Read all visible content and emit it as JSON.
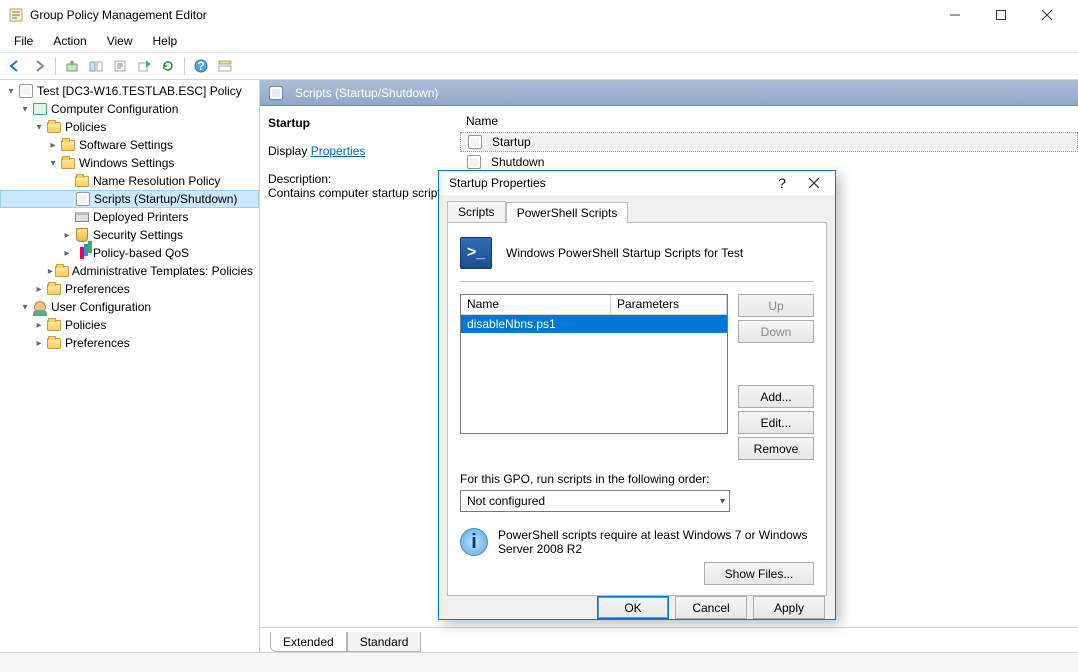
{
  "window": {
    "title": "Group Policy Management Editor"
  },
  "menu": {
    "file": "File",
    "action": "Action",
    "view": "View",
    "help": "Help"
  },
  "tree": {
    "root": "Test [DC3-W16.TESTLAB.ESC] Policy",
    "compConfig": "Computer Configuration",
    "policies": "Policies",
    "software": "Software Settings",
    "windows": "Windows Settings",
    "nrp": "Name Resolution Policy",
    "scripts": "Scripts (Startup/Shutdown)",
    "printers": "Deployed Printers",
    "security": "Security Settings",
    "qos": "Policy-based QoS",
    "admin": "Administrative Templates: Policies",
    "prefs": "Preferences",
    "userConfig": "User Configuration",
    "uPolicies": "Policies",
    "uPrefs": "Preferences"
  },
  "content": {
    "headerTitle": "Scripts (Startup/Shutdown)",
    "detailHeading": "Startup",
    "displayLabel": "Display ",
    "propertiesLink": "Properties ",
    "descLabel": "Description:",
    "descText": "Contains computer startup scripts.",
    "colName": "Name",
    "items": {
      "startup": "Startup",
      "shutdown": "Shutdown"
    },
    "tabs": {
      "extended": "Extended",
      "standard": "Standard"
    }
  },
  "dialog": {
    "title": "Startup Properties",
    "tabs": {
      "scripts": "Scripts",
      "ps": "PowerShell Scripts"
    },
    "headerText": "Windows PowerShell Startup Scripts for Test",
    "cols": {
      "name": "Name",
      "params": "Parameters"
    },
    "rows": [
      {
        "name": "disableNbns.ps1",
        "params": ""
      }
    ],
    "buttons": {
      "up": "Up",
      "down": "Down",
      "add": "Add...",
      "edit": "Edit...",
      "remove": "Remove",
      "showFiles": "Show Files...",
      "ok": "OK",
      "cancel": "Cancel",
      "apply": "Apply"
    },
    "orderLabel": "For this GPO, run scripts in the following order:",
    "orderValue": "Not configured",
    "infoText": "PowerShell scripts require at least Windows 7 or Windows Server 2008 R2"
  }
}
